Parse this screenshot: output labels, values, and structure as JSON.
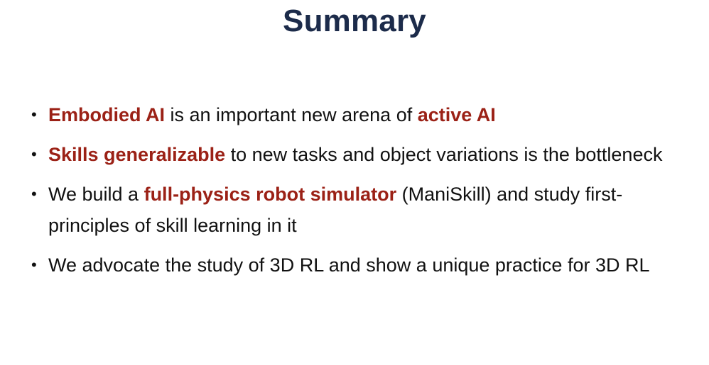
{
  "title": "Summary",
  "bullets": [
    {
      "segments": [
        {
          "text": "Embodied AI",
          "highlight": true
        },
        {
          "text": " is an important new arena of ",
          "highlight": false
        },
        {
          "text": "active AI",
          "highlight": true
        }
      ]
    },
    {
      "segments": [
        {
          "text": "Skills generalizable",
          "highlight": true
        },
        {
          "text": " to new tasks and object variations is the bottleneck",
          "highlight": false
        }
      ]
    },
    {
      "segments": [
        {
          "text": "We build a ",
          "highlight": false
        },
        {
          "text": "full-physics robot simulator",
          "highlight": true
        },
        {
          "text": " (ManiSkill) and study first-principles of skill learning in it",
          "highlight": false
        }
      ]
    },
    {
      "segments": [
        {
          "text": "We advocate the study of 3D RL and show a unique practice for 3D RL",
          "highlight": false
        }
      ]
    }
  ],
  "colors": {
    "title": "#1c2b4a",
    "highlight": "#9b2116",
    "body": "#111111"
  }
}
